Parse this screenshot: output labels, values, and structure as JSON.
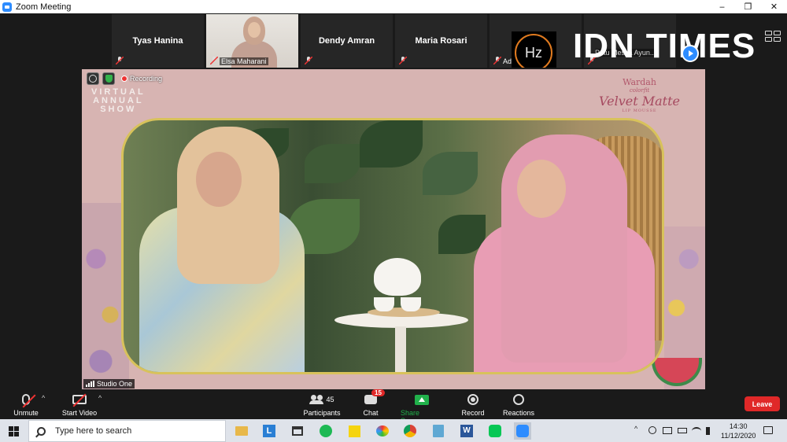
{
  "window": {
    "title": "Zoom Meeting",
    "controls": {
      "minimize": "‒",
      "maximize": "❐",
      "close": "✕"
    }
  },
  "gallery": [
    {
      "name": "Tyas Hanina",
      "muted": true,
      "has_video": false
    },
    {
      "name": "Elsa Maharani",
      "muted": true,
      "has_video": true
    },
    {
      "name": "Dendy Amran",
      "muted": true,
      "has_video": false
    },
    {
      "name": "Maria Rosari",
      "muted": true,
      "has_video": false
    },
    {
      "name": "Adityo Firma...",
      "muted": true,
      "has_video": true,
      "avatar_text": "Hz"
    },
    {
      "name": "Putu Mestia Ayun...",
      "muted": true,
      "has_video": false
    }
  ],
  "watermark": {
    "text_left": "IDN",
    "text_right": "TIMES"
  },
  "stage": {
    "recording_label": "Recording",
    "event_logo_text": "VIRTUAL\nANNUAL\nSHOW",
    "brand": {
      "line1": "Wardah",
      "line2": "colorfit",
      "line3": "Velvet Matte",
      "line4": "LIP MOUSSE"
    },
    "speaker_label": "Studio One"
  },
  "toolbar": {
    "unmute": "Unmute",
    "start_video": "Start Video",
    "participants": "Participants",
    "participants_count": "45",
    "chat": "Chat",
    "chat_badge": "15",
    "share_screen": "Share Screen",
    "record": "Record",
    "reactions": "Reactions",
    "leave": "Leave"
  },
  "taskbar": {
    "search_placeholder": "Type here to search",
    "time": "14:30",
    "date": "11/12/2020"
  },
  "colors": {
    "zoom_blue": "#2d8cff",
    "leave_red": "#e02828",
    "share_green": "#21b14b",
    "frame_gold": "#d8c25b"
  }
}
